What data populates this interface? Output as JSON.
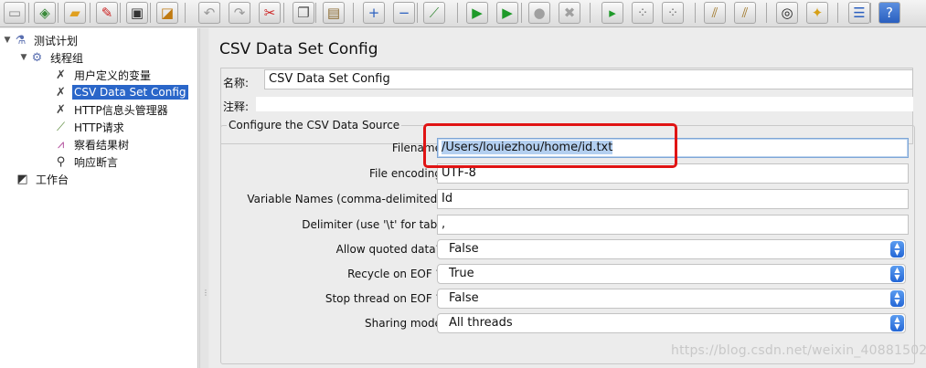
{
  "toolbar": {
    "buttons": [
      {
        "name": "new-icon",
        "glyph": "▭",
        "color": "#ffffff"
      },
      {
        "name": "templates-icon",
        "glyph": "◈",
        "color": "#3a8a3a"
      },
      {
        "name": "open-icon",
        "glyph": "▰",
        "color": "#e0a020"
      },
      {
        "name": "close-icon",
        "glyph": "✎",
        "color": "#cc2222"
      },
      {
        "name": "save-icon",
        "glyph": "▣",
        "color": "#333333"
      },
      {
        "name": "save-as-icon",
        "glyph": "◪",
        "color": "#c07a10"
      },
      {
        "name": "undo-icon",
        "glyph": "↶",
        "color": "#9a9a9a"
      },
      {
        "name": "redo-icon",
        "glyph": "↷",
        "color": "#9a9a9a"
      },
      {
        "name": "cut-icon",
        "glyph": "✂",
        "color": "#cc2222"
      },
      {
        "name": "copy-icon",
        "glyph": "❐",
        "color": "#555555"
      },
      {
        "name": "paste-icon",
        "glyph": "▤",
        "color": "#8a6a30"
      },
      {
        "name": "expand-icon",
        "glyph": "+",
        "color": "#2a5fbf"
      },
      {
        "name": "collapse-icon",
        "glyph": "−",
        "color": "#2a5fbf"
      },
      {
        "name": "toggle-icon",
        "glyph": "⟋",
        "color": "#3a8a3a"
      },
      {
        "name": "start-icon",
        "glyph": "▶",
        "color": "#1f9a2a"
      },
      {
        "name": "start-no-pauses-icon",
        "glyph": "▶",
        "color": "#1f9a2a"
      },
      {
        "name": "stop-icon",
        "glyph": "●",
        "color": "#a0a0a0"
      },
      {
        "name": "shutdown-icon",
        "glyph": "✖",
        "color": "#a0a0a0"
      },
      {
        "name": "remote-start-icon",
        "glyph": "▸",
        "color": "#1f9a2a"
      },
      {
        "name": "remote-stop-icon",
        "glyph": "⁘",
        "color": "#777777"
      },
      {
        "name": "remote-exit-icon",
        "glyph": "⁘",
        "color": "#777777"
      },
      {
        "name": "clear-icon",
        "glyph": "⫽",
        "color": "#a0782a"
      },
      {
        "name": "clear-all-icon",
        "glyph": "⫽",
        "color": "#a0782a"
      },
      {
        "name": "search-icon",
        "glyph": "◎",
        "color": "#222222"
      },
      {
        "name": "reset-search-icon",
        "glyph": "✦",
        "color": "#d6a018"
      },
      {
        "name": "function-helper-icon",
        "glyph": "☰",
        "color": "#2a5fbf"
      },
      {
        "name": "help-icon",
        "glyph": "?",
        "color": "#ffffff"
      }
    ]
  },
  "tree": {
    "items": [
      {
        "label": "测试计划",
        "icon": "test-plan-icon",
        "glyph": "⚗",
        "color": "#5a6fb0"
      },
      {
        "label": "线程组",
        "icon": "thread-group-icon",
        "glyph": "⚙",
        "color": "#5a6fb0"
      },
      {
        "label": "用户定义的变量",
        "icon": "config-wrench-icon",
        "glyph": "✗",
        "color": "#444444"
      },
      {
        "label": "CSV Data Set Config",
        "icon": "config-wrench-icon",
        "glyph": "✗",
        "color": "#444444"
      },
      {
        "label": "HTTP信息头管理器",
        "icon": "config-wrench-icon",
        "glyph": "✗",
        "color": "#444444"
      },
      {
        "label": "HTTP请求",
        "icon": "sampler-pipette-icon",
        "glyph": "⟋",
        "color": "#5a8a3a"
      },
      {
        "label": "察看结果树",
        "icon": "listener-chart-icon",
        "glyph": "⩘",
        "color": "#b04a9a"
      },
      {
        "label": "响应断言",
        "icon": "assertion-magnifier-icon",
        "glyph": "⚲",
        "color": "#333333"
      },
      {
        "label": "工作台",
        "icon": "workbench-icon",
        "glyph": "◩",
        "color": "#333333"
      }
    ]
  },
  "panel": {
    "title": "CSV Data Set Config",
    "name_label": "名称:",
    "name_value": "CSV Data Set Config",
    "comment_label": "注释:",
    "comment_value": "",
    "group_title": "Configure the CSV Data Source",
    "fields": {
      "filename_label": "Filename:",
      "filename_value": "/Users/louiezhou/home/id.txt",
      "encoding_label": "File encoding:",
      "encoding_value": "UTF-8",
      "varnames_label": "Variable Names (comma-delimited):",
      "varnames_value": "Id",
      "delimiter_label": "Delimiter (use '\\t' for tab):",
      "delimiter_value": ","
    },
    "combos": [
      {
        "label": "Allow quoted data?:",
        "value": "False"
      },
      {
        "label": "Recycle on EOF ?:",
        "value": "True"
      },
      {
        "label": "Stop thread on EOF ?:",
        "value": "False"
      },
      {
        "label": "Sharing mode:",
        "value": "All threads"
      }
    ]
  },
  "watermark": "https://blog.csdn.net/weixin_40881502",
  "colors": {
    "selection": "#2a66c9",
    "highlight_box": "#e01414",
    "combo_arrow": "#2467d6"
  }
}
